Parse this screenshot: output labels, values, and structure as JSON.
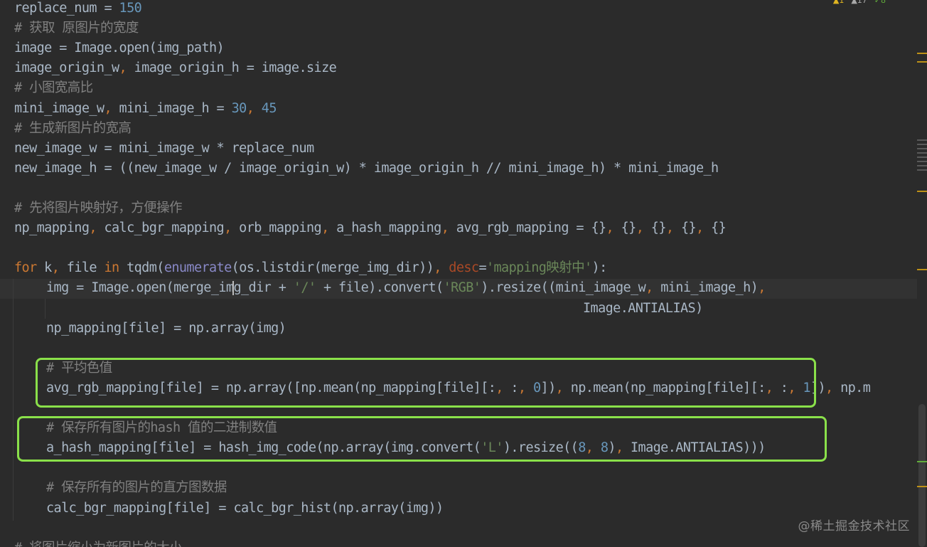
{
  "editor": {
    "lines": [
      {
        "tokens": [
          {
            "t": "replace_num = ",
            "c": "p"
          },
          {
            "t": "150",
            "c": "num"
          }
        ]
      },
      {
        "tokens": [
          {
            "t": "# 获取 原图片的宽度",
            "c": "cm"
          }
        ]
      },
      {
        "tokens": [
          {
            "t": "image = Image.open(img_path)",
            "c": "p"
          }
        ]
      },
      {
        "tokens": [
          {
            "t": "image_origin_w",
            "c": "p"
          },
          {
            "t": ", ",
            "c": "kw"
          },
          {
            "t": "image_origin_h = image.size",
            "c": "p"
          }
        ]
      },
      {
        "tokens": [
          {
            "t": "# 小图宽高比",
            "c": "cm"
          }
        ]
      },
      {
        "tokens": [
          {
            "t": "mini_image_w",
            "c": "p"
          },
          {
            "t": ", ",
            "c": "kw"
          },
          {
            "t": "mini_image_h = ",
            "c": "p"
          },
          {
            "t": "30",
            "c": "num"
          },
          {
            "t": ", ",
            "c": "kw"
          },
          {
            "t": "45",
            "c": "num"
          }
        ]
      },
      {
        "tokens": [
          {
            "t": "# 生成新图片的宽高",
            "c": "cm"
          }
        ]
      },
      {
        "tokens": [
          {
            "t": "new_image_w = mini_image_w * replace_num",
            "c": "p"
          }
        ]
      },
      {
        "tokens": [
          {
            "t": "new_image_h = ((new_image_w / image_origin_w) * image_origin_h // mini_image_h) * mini_image_h",
            "c": "p"
          }
        ]
      },
      {
        "tokens": []
      },
      {
        "tokens": [
          {
            "t": "# 先将图片映射好，方便操作",
            "c": "cm"
          }
        ]
      },
      {
        "tokens": [
          {
            "t": "np_mapping",
            "c": "p"
          },
          {
            "t": ", ",
            "c": "kw"
          },
          {
            "t": "calc_bgr_mapping",
            "c": "p"
          },
          {
            "t": ", ",
            "c": "kw"
          },
          {
            "t": "orb_mapping",
            "c": "p"
          },
          {
            "t": ", ",
            "c": "kw"
          },
          {
            "t": "a_hash_mapping",
            "c": "p"
          },
          {
            "t": ", ",
            "c": "kw"
          },
          {
            "t": "avg_rgb_mapping = {}",
            "c": "p"
          },
          {
            "t": ", ",
            "c": "kw"
          },
          {
            "t": "{}",
            "c": "p"
          },
          {
            "t": ", ",
            "c": "kw"
          },
          {
            "t": "{}",
            "c": "p"
          },
          {
            "t": ", ",
            "c": "kw"
          },
          {
            "t": "{}",
            "c": "p"
          },
          {
            "t": ", ",
            "c": "kw"
          },
          {
            "t": "{}",
            "c": "p"
          }
        ]
      },
      {
        "tokens": []
      },
      {
        "tokens": [
          {
            "t": "for ",
            "c": "kw"
          },
          {
            "t": "k",
            "c": "p"
          },
          {
            "t": ", ",
            "c": "kw"
          },
          {
            "t": "file ",
            "c": "p"
          },
          {
            "t": "in ",
            "c": "kw"
          },
          {
            "t": "tqdm(",
            "c": "p"
          },
          {
            "t": "enumerate",
            "c": "fn"
          },
          {
            "t": "(os.listdir(",
            "c": "p"
          },
          {
            "t": "merge_img_dir",
            "c": "hl"
          },
          {
            "t": "))",
            "c": "p"
          },
          {
            "t": ", ",
            "c": "kw"
          },
          {
            "t": "desc",
            "c": "kwarg"
          },
          {
            "t": "=",
            "c": "p"
          },
          {
            "t": "'mapping映射中'",
            "c": "str"
          },
          {
            "t": "):",
            "c": "p"
          }
        ]
      },
      {
        "indent": 1,
        "tokens": [
          {
            "t": "img = Image.open(",
            "c": "p"
          },
          {
            "t": "merge_im",
            "c": "hl"
          },
          {
            "t": "",
            "c": "caret"
          },
          {
            "t": "g_dir",
            "c": "hl"
          },
          {
            "t": " + ",
            "c": "p"
          },
          {
            "t": "'/'",
            "c": "str"
          },
          {
            "t": " + file).convert(",
            "c": "p"
          },
          {
            "t": "'RGB'",
            "c": "str"
          },
          {
            "t": ").resize((mini_image_w",
            "c": "p"
          },
          {
            "t": ", ",
            "c": "kw"
          },
          {
            "t": "mini_image_h)",
            "c": "p"
          },
          {
            "t": ",",
            "c": "kw"
          }
        ]
      },
      {
        "indent": 2,
        "tokens": [
          {
            "t": "Image.ANTIALIAS)",
            "c": "p"
          }
        ]
      },
      {
        "indent": 1,
        "tokens": [
          {
            "t": "np_mapping[file] = np.array(img)",
            "c": "p"
          }
        ]
      },
      {
        "tokens": []
      },
      {
        "indent": 1,
        "tokens": [
          {
            "t": "# 平均色值",
            "c": "cm"
          }
        ]
      },
      {
        "indent": 1,
        "tokens": [
          {
            "t": "avg_rgb_mapping[file] = np.array([np.mean(np_mapping[file][:",
            "c": "p"
          },
          {
            "t": ", ",
            "c": "kw"
          },
          {
            "t": ":",
            "c": "p"
          },
          {
            "t": ", ",
            "c": "kw"
          },
          {
            "t": "0",
            "c": "num"
          },
          {
            "t": "])",
            "c": "p"
          },
          {
            "t": ", ",
            "c": "kw"
          },
          {
            "t": "np.mean(np_mapping[file][:",
            "c": "p"
          },
          {
            "t": ", ",
            "c": "kw"
          },
          {
            "t": ":",
            "c": "p"
          },
          {
            "t": ", ",
            "c": "kw"
          },
          {
            "t": "1",
            "c": "num"
          },
          {
            "t": "])",
            "c": "p"
          },
          {
            "t": ", ",
            "c": "kw"
          },
          {
            "t": "np.m",
            "c": "p"
          }
        ]
      },
      {
        "tokens": []
      },
      {
        "indent": 1,
        "tokens": [
          {
            "t": "# 保存所有图片的hash 值的二进制数值",
            "c": "cm"
          }
        ]
      },
      {
        "indent": 1,
        "tokens": [
          {
            "t": "a_hash_mapping[file] = hash_img_code(np.array(img.convert(",
            "c": "p"
          },
          {
            "t": "'L'",
            "c": "str"
          },
          {
            "t": ").resize((",
            "c": "p"
          },
          {
            "t": "8",
            "c": "num"
          },
          {
            "t": ", ",
            "c": "kw"
          },
          {
            "t": "8",
            "c": "num"
          },
          {
            "t": ")",
            "c": "p"
          },
          {
            "t": ", ",
            "c": "kw"
          },
          {
            "t": "Image.ANTIALIAS)))",
            "c": "p"
          }
        ]
      },
      {
        "tokens": []
      },
      {
        "indent": 1,
        "tokens": [
          {
            "t": "# 保存所有的图片的直方图数据",
            "c": "cm"
          }
        ]
      },
      {
        "indent": 1,
        "tokens": [
          {
            "t": "calc_bgr_mapping[file] = calc_bgr_hist(np.array(img))",
            "c": "p"
          }
        ]
      },
      {
        "tokens": []
      },
      {
        "tokens": [
          {
            "t": "# 将图片缩小为新图片的大小",
            "c": "cm"
          }
        ]
      }
    ]
  },
  "inspection": {
    "warnings": "1",
    "weak_warnings": "17",
    "typos": "8"
  },
  "colors": {
    "highlight_box": "#8ae04a",
    "warning": "#be9117"
  },
  "watermark": "@稀土掘金技术社区"
}
